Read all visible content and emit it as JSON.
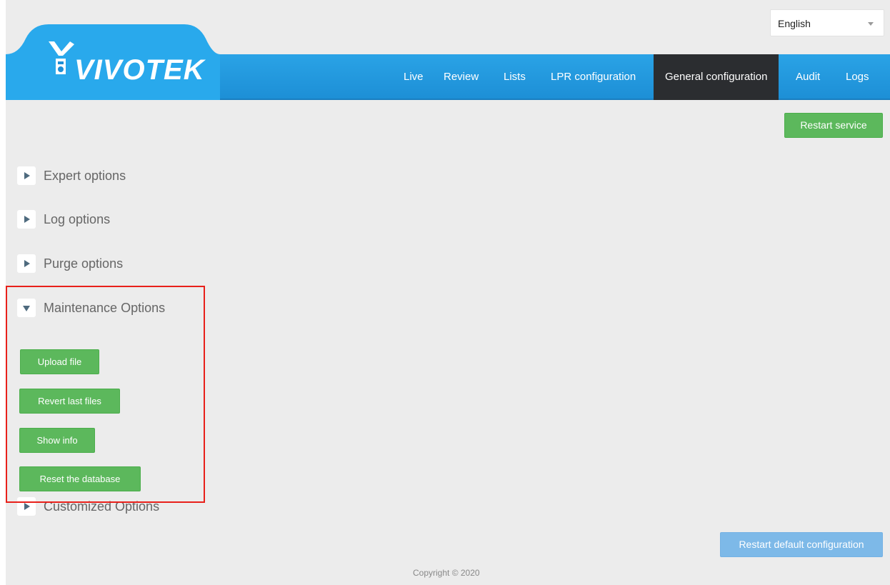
{
  "language": {
    "selected": "English"
  },
  "brand": {
    "logo_text": "VIVOTEK"
  },
  "nav": {
    "live": "Live",
    "review": "Review",
    "lists": "Lists",
    "lpr_configuration": "LPR configuration",
    "general_configuration": "General configuration",
    "audit": "Audit",
    "logs": "Logs"
  },
  "actions": {
    "restart_service": "Restart service",
    "restart_default_configuration": "Restart default configuration"
  },
  "sections": {
    "expert": "Expert options",
    "log": "Log options",
    "purge": "Purge options",
    "maintenance": "Maintenance Options",
    "customized": "Customized Options"
  },
  "maintenance": {
    "upload_file": "Upload file",
    "revert_last_files": "Revert last files",
    "show_info": "Show info",
    "reset_database": "Reset the database"
  },
  "footer": {
    "copyright": "Copyright © 2020"
  },
  "colors": {
    "header_blue": "#1d8fd6",
    "nav_active": "#2b2d30",
    "button_green": "#5cb85c",
    "button_light_blue": "#7db9e8",
    "highlight_red": "#e8201a"
  }
}
